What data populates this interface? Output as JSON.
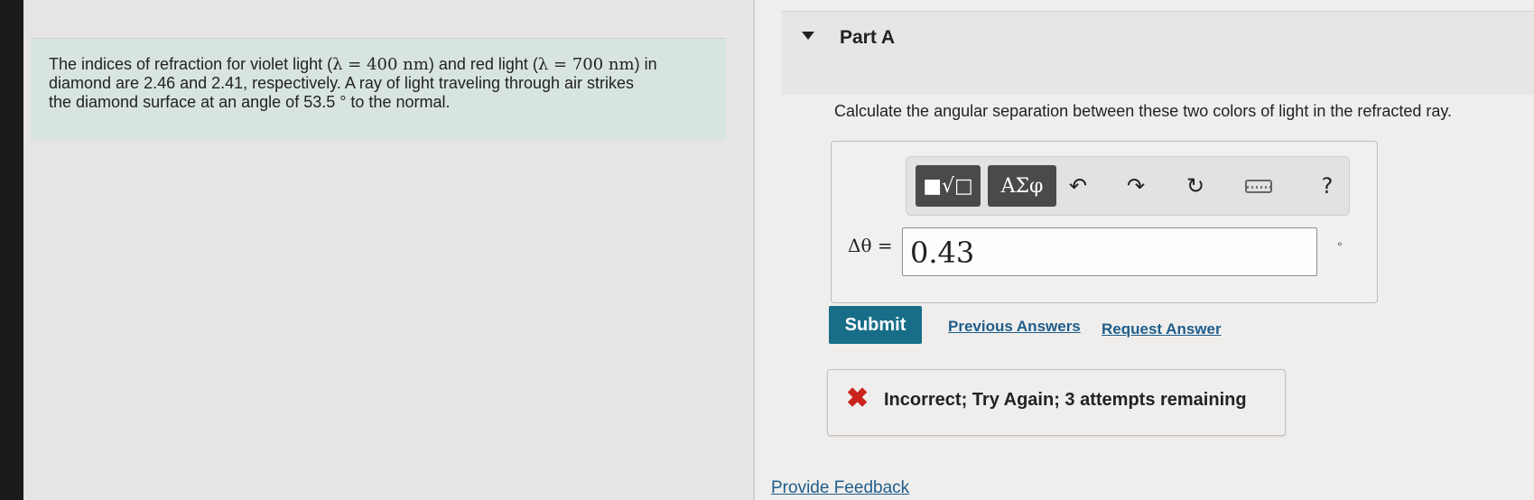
{
  "problem": {
    "line1_a": "The indices of refraction for violet light (",
    "lambda_violet": "λ = 400 nm",
    "line1_b": ") and red light (",
    "lambda_red": "λ = 700 nm",
    "line1_c": ") in",
    "line2": "diamond are 2.46 and 2.41, respectively. A ray of light traveling through air strikes",
    "line3": "the diamond surface at an angle of 53.5 ° to the normal."
  },
  "part": {
    "title": "Part A",
    "question": "Calculate the angular separation between these two colors of light in the refracted ray."
  },
  "toolbar": {
    "templates_label": "■√□",
    "greek_label": "ΑΣφ",
    "undo_label": "↶",
    "redo_label": "↷",
    "reset_label": "↻",
    "help_label": "?"
  },
  "answer": {
    "variable_label": "Δθ =",
    "value": "0.43",
    "unit": "°"
  },
  "actions": {
    "submit_label": "Submit",
    "previous_answers_label": "Previous Answers",
    "request_answer_label": "Request Answer"
  },
  "feedback": {
    "icon": "✖",
    "message": "Incorrect; Try Again; 3 attempts remaining"
  },
  "footer": {
    "provide_feedback_label": "Provide Feedback"
  },
  "colors": {
    "submit_bg": "#186e88",
    "link": "#1f5d8c",
    "error": "#c8241b",
    "problem_bg": "#d8e5df"
  }
}
